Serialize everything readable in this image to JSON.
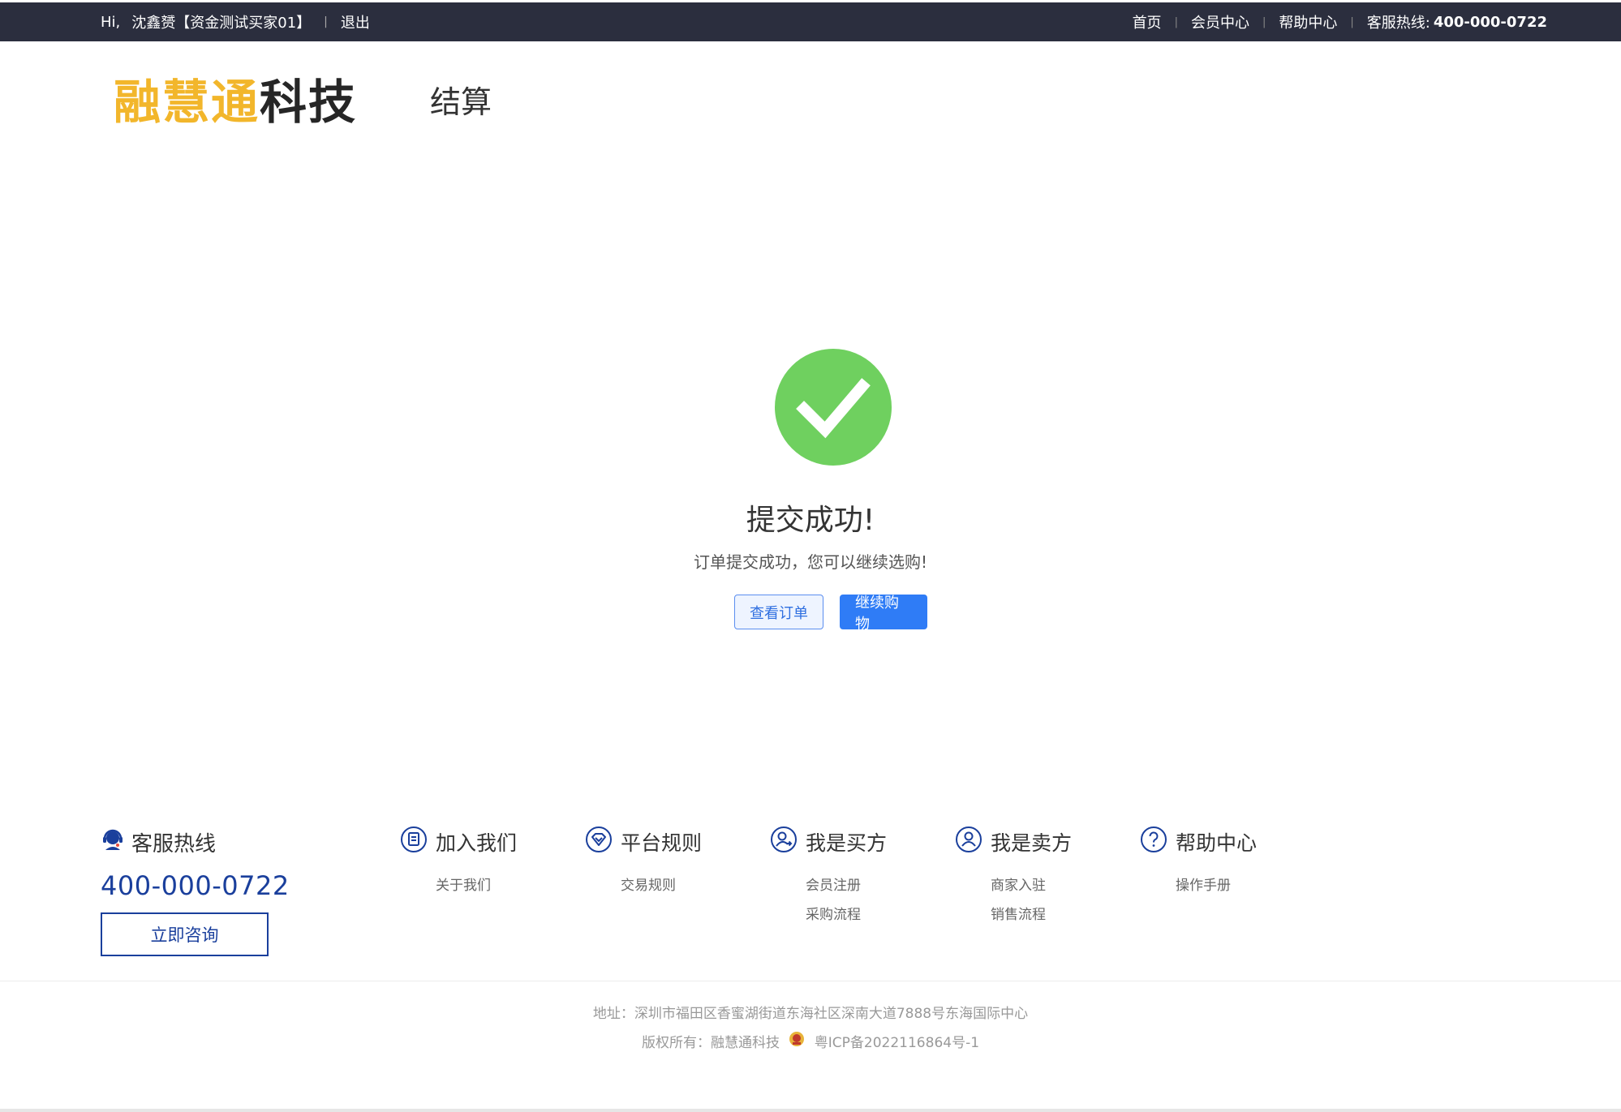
{
  "topbar": {
    "greeting": "Hi,",
    "username": "沈鑫赟【资金测试买家01】",
    "logout": "退出",
    "nav": [
      "首页",
      "会员中心",
      "帮助中心"
    ],
    "hotline_label": "客服热线:",
    "hotline_number": "400-000-0722"
  },
  "header": {
    "logo_gold": "融慧通",
    "logo_dark": "科技",
    "page_label": "结算"
  },
  "success": {
    "title": "提交成功!",
    "subtitle": "订单提交成功，您可以继续选购!",
    "view_order": "查看订单",
    "continue_shopping": "继续购物",
    "icon": "check-circle-icon",
    "icon_color": "#6fd05f"
  },
  "footer": {
    "service": {
      "title": "客服热线",
      "phone": "400-000-0722",
      "consult_button": "立即咨询"
    },
    "columns": [
      {
        "title": "加入我们",
        "icon": "document-icon",
        "links": [
          "关于我们"
        ]
      },
      {
        "title": "平台规则",
        "icon": "diamond-icon",
        "links": [
          "交易规则"
        ]
      },
      {
        "title": "我是买方",
        "icon": "user-arrow-icon",
        "links": [
          "会员注册",
          "采购流程"
        ]
      },
      {
        "title": "我是卖方",
        "icon": "user-icon",
        "links": [
          "商家入驻",
          "销售流程"
        ]
      },
      {
        "title": "帮助中心",
        "icon": "question-icon",
        "links": [
          "操作手册"
        ]
      }
    ],
    "address": "地址：深圳市福田区香蜜湖街道东海社区深南大道7888号东海国际中心",
    "copyright_label": "版权所有：融慧通科技",
    "icp": "粤ICP备2022116864号-1"
  },
  "colors": {
    "topbar_bg": "#2b2e3e",
    "logo_gold": "#f2b62b",
    "primary_blue": "#2f7cf6",
    "footer_blue": "#1a3f9c",
    "success_green": "#6fd05f"
  }
}
